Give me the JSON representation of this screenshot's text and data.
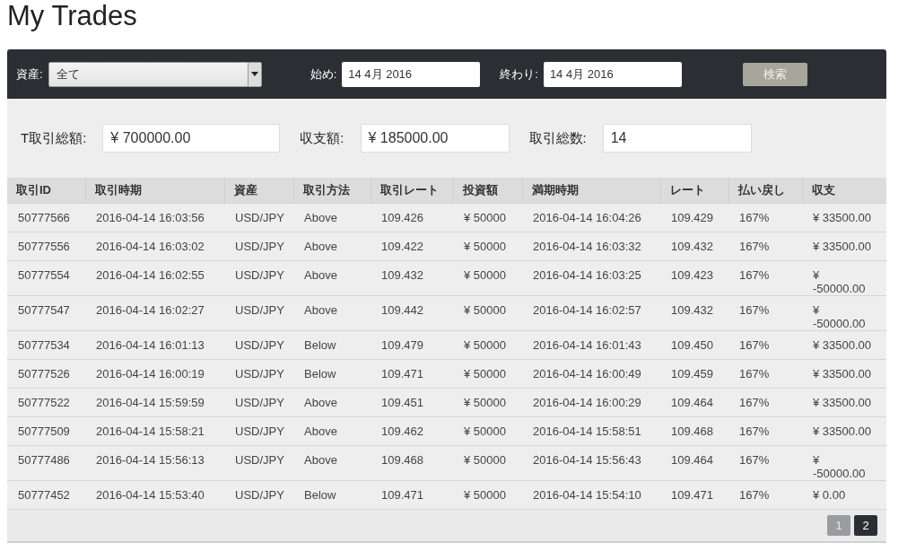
{
  "title": "My Trades",
  "filters": {
    "asset_label": "資産:",
    "asset_value": "全て",
    "start_label": "始め:",
    "start_value": "14 4月 2016",
    "end_label": "終わり:",
    "end_value": "14 4月 2016",
    "search_button": "検索"
  },
  "summary": [
    {
      "label": "T取引総額:",
      "value": "¥ 700000.00"
    },
    {
      "label": "収支額:",
      "value": "¥ 185000.00"
    },
    {
      "label": "取引総数:",
      "value": "14"
    }
  ],
  "table": {
    "columns": [
      "取引ID",
      "取引時期",
      "資産",
      "取引方法",
      "取引レート",
      "投資額",
      "満期時期",
      "レート",
      "払い戻し",
      "収支"
    ],
    "rows": [
      [
        "50777566",
        "2016-04-14 16:03:56",
        "USD/JPY",
        "Above",
        "109.426",
        "¥ 50000",
        "2016-04-14 16:04:26",
        "109.429",
        "167%",
        "¥ 33500.00"
      ],
      [
        "50777556",
        "2016-04-14 16:03:02",
        "USD/JPY",
        "Above",
        "109.422",
        "¥ 50000",
        "2016-04-14 16:03:32",
        "109.432",
        "167%",
        "¥ 33500.00"
      ],
      [
        "50777554",
        "2016-04-14 16:02:55",
        "USD/JPY",
        "Above",
        "109.432",
        "¥ 50000",
        "2016-04-14 16:03:25",
        "109.423",
        "167%",
        "¥ -50000.00"
      ],
      [
        "50777547",
        "2016-04-14 16:02:27",
        "USD/JPY",
        "Above",
        "109.442",
        "¥ 50000",
        "2016-04-14 16:02:57",
        "109.432",
        "167%",
        "¥ -50000.00"
      ],
      [
        "50777534",
        "2016-04-14 16:01:13",
        "USD/JPY",
        "Below",
        "109.479",
        "¥ 50000",
        "2016-04-14 16:01:43",
        "109.450",
        "167%",
        "¥ 33500.00"
      ],
      [
        "50777526",
        "2016-04-14 16:00:19",
        "USD/JPY",
        "Below",
        "109.471",
        "¥ 50000",
        "2016-04-14 16:00:49",
        "109.459",
        "167%",
        "¥ 33500.00"
      ],
      [
        "50777522",
        "2016-04-14 15:59:59",
        "USD/JPY",
        "Above",
        "109.451",
        "¥ 50000",
        "2016-04-14 16:00:29",
        "109.464",
        "167%",
        "¥ 33500.00"
      ],
      [
        "50777509",
        "2016-04-14 15:58:21",
        "USD/JPY",
        "Above",
        "109.462",
        "¥ 50000",
        "2016-04-14 15:58:51",
        "109.468",
        "167%",
        "¥ 33500.00"
      ],
      [
        "50777486",
        "2016-04-14 15:56:13",
        "USD/JPY",
        "Above",
        "109.468",
        "¥ 50000",
        "2016-04-14 15:56:43",
        "109.464",
        "167%",
        "¥ -50000.00"
      ],
      [
        "50777452",
        "2016-04-14 15:53:40",
        "USD/JPY",
        "Below",
        "109.471",
        "¥ 50000",
        "2016-04-14 15:54:10",
        "109.471",
        "167%",
        "¥ 0.00"
      ]
    ]
  },
  "pagination": [
    {
      "label": "1",
      "selected": true
    },
    {
      "label": "2",
      "selected": false
    }
  ]
}
